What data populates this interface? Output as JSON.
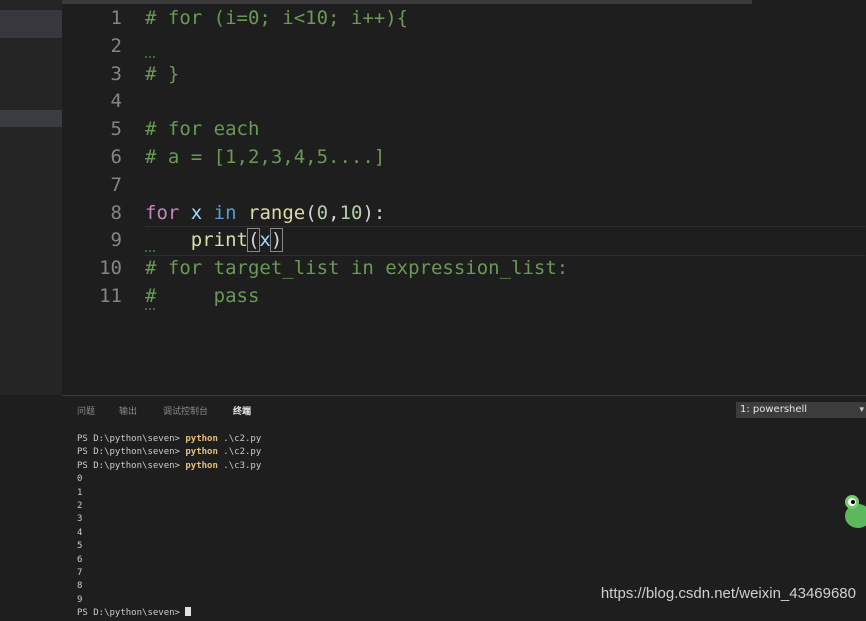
{
  "editor": {
    "lines": [
      {
        "num": "1",
        "segments": [
          {
            "t": "# for (i=0; i<10; i++){",
            "c": "cm"
          }
        ]
      },
      {
        "num": "2",
        "segments": []
      },
      {
        "num": "3",
        "segments": [
          {
            "t": "# }",
            "c": "cm"
          }
        ]
      },
      {
        "num": "4",
        "segments": []
      },
      {
        "num": "5",
        "segments": [
          {
            "t": "# for each",
            "c": "cm"
          }
        ]
      },
      {
        "num": "6",
        "segments": [
          {
            "t": "# a = [1,2,3,4,5....]",
            "c": "cm"
          }
        ]
      },
      {
        "num": "7",
        "segments": []
      },
      {
        "num": "8",
        "segments": [
          {
            "t": "for",
            "c": "kw"
          },
          {
            "t": " x ",
            "c": "var"
          },
          {
            "t": "in",
            "c": "ctl"
          },
          {
            "t": " ",
            "c": "pn"
          },
          {
            "t": "range",
            "c": "fn"
          },
          {
            "t": "(",
            "c": "pn"
          },
          {
            "t": "0",
            "c": "nm"
          },
          {
            "t": ",",
            "c": "pn"
          },
          {
            "t": "10",
            "c": "nm"
          },
          {
            "t": "):",
            "c": "pn"
          }
        ]
      },
      {
        "num": "9",
        "segments": [
          {
            "t": "    ",
            "c": "pn"
          },
          {
            "t": "print",
            "c": "fn"
          },
          {
            "t": "(",
            "c": "pn bracket"
          },
          {
            "t": "x",
            "c": "var"
          },
          {
            "t": ")",
            "c": "pn bracket"
          }
        ]
      },
      {
        "num": "10",
        "segments": [
          {
            "t": "# for target_list in expression_list:",
            "c": "cm"
          }
        ]
      },
      {
        "num": "11",
        "segments": [
          {
            "t": "#     pass",
            "c": "cm"
          }
        ]
      }
    ]
  },
  "panel": {
    "tabs": [
      {
        "label": "问题"
      },
      {
        "label": "输出"
      },
      {
        "label": "调试控制台"
      },
      {
        "label": "终端",
        "active": true
      }
    ],
    "terminal_select": "1: powershell",
    "terminal": {
      "prompt": "PS D:\\python\\seven> ",
      "commands": [
        {
          "cmd": "python",
          "arg": " .\\c2.py"
        },
        {
          "cmd": "python",
          "arg": " .\\c2.py"
        },
        {
          "cmd": "python",
          "arg": " .\\c3.py"
        }
      ],
      "output": [
        "0",
        "1",
        "2",
        "3",
        "4",
        "5",
        "6",
        "7",
        "8",
        "9"
      ],
      "final_prompt": "PS D:\\python\\seven> "
    }
  },
  "watermark": "https://blog.csdn.net/weixin_43469680",
  "colors": {
    "comment": "#6a9955",
    "keyword": "#c586c0",
    "function": "#dcdcaa",
    "number": "#b5cea8",
    "python_cmd": "#e5c07b"
  }
}
